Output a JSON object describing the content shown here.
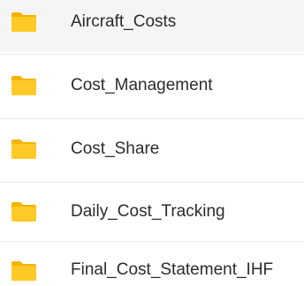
{
  "folders": [
    {
      "name": "Aircraft_Costs",
      "icon": "folder-icon"
    },
    {
      "name": "Cost_Management",
      "icon": "folder-icon"
    },
    {
      "name": "Cost_Share",
      "icon": "folder-icon"
    },
    {
      "name": "Daily_Cost_Tracking",
      "icon": "folder-icon"
    },
    {
      "name": "Final_Cost_Statement_IHF",
      "icon": "folder-icon"
    }
  ],
  "colors": {
    "folder_front": "#FFCA28",
    "folder_back": "#F4B400",
    "text": "#2B2B2B",
    "divider": "#ECECEC"
  }
}
